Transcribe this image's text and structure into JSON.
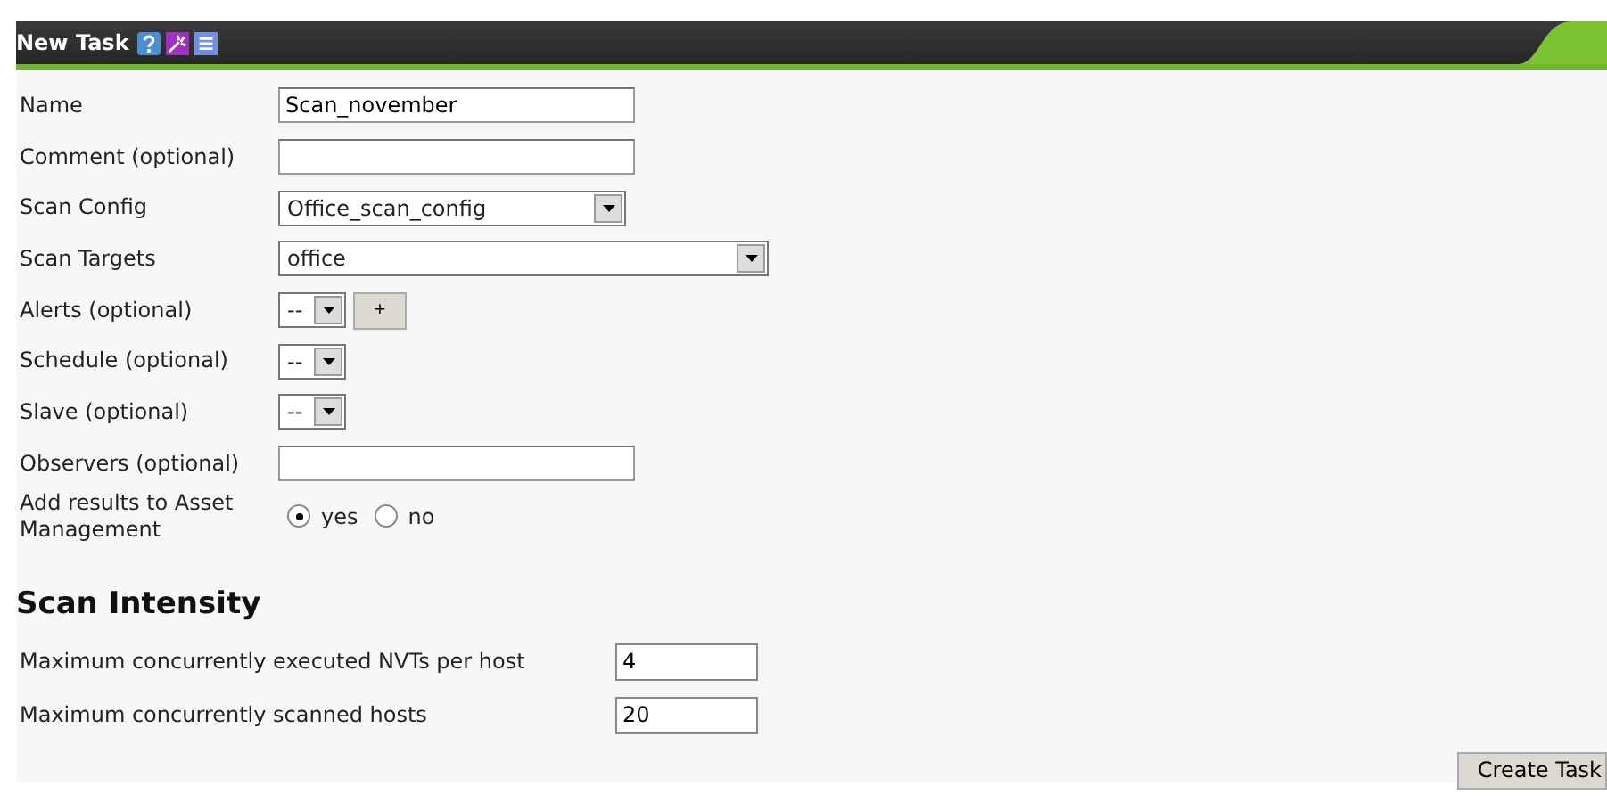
{
  "header": {
    "title": "New Task"
  },
  "fields": [
    {
      "kind": "text",
      "label": "Name",
      "value": "Scan_november"
    },
    {
      "kind": "text",
      "label": "Comment (optional)"
    },
    {
      "kind": "select",
      "label": "Scan Config",
      "value": "Office_scan_config"
    },
    {
      "kind": "select",
      "label": "Scan Targets",
      "value": "office"
    },
    {
      "kind": "select",
      "label": "Alerts (optional)",
      "value": "--",
      "button": "+"
    },
    {
      "kind": "select",
      "label": "Schedule (optional)",
      "value": "--"
    },
    {
      "kind": "select",
      "label": "Slave (optional)",
      "value": "--"
    },
    {
      "kind": "text",
      "label": "Observers (optional)"
    },
    {
      "kind": "radio",
      "label": "Add results to Asset Management",
      "options": [
        {
          "label": "yes",
          "selected": true
        },
        {
          "label": "no",
          "selected": false
        }
      ]
    }
  ],
  "intensity": {
    "title": "Scan Intensity",
    "fields": [
      {
        "label": "Maximum concurrently executed NVTs per host",
        "value": "4"
      },
      {
        "label": "Maximum concurrently scanned hosts",
        "value": "20"
      }
    ]
  },
  "submit": "Create Task"
}
